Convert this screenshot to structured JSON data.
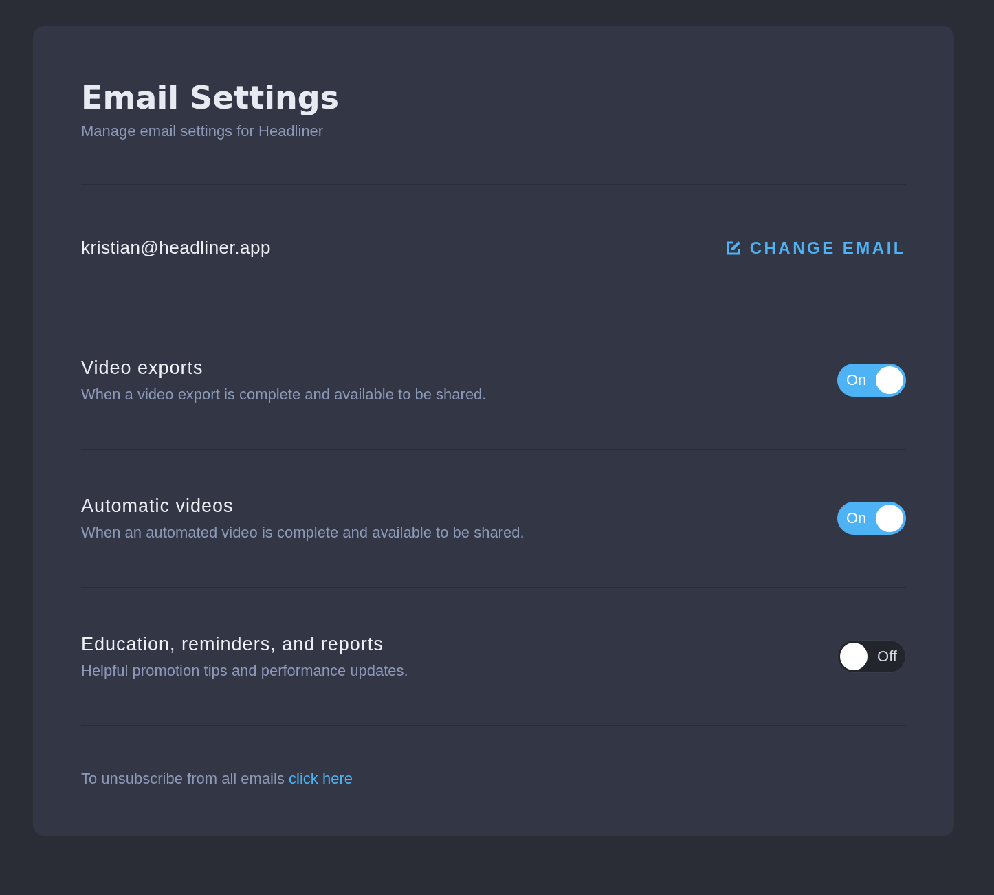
{
  "header": {
    "title": "Email Settings",
    "subtitle": "Manage email settings for Headliner"
  },
  "account": {
    "email": "kristian@headliner.app",
    "change_label": "CHANGE EMAIL"
  },
  "settings": [
    {
      "title": "Video exports",
      "description": "When a video export is complete and available to be shared.",
      "on": true,
      "state_label": "On"
    },
    {
      "title": "Automatic videos",
      "description": "When an automated video is complete and available to be shared.",
      "on": true,
      "state_label": "On"
    },
    {
      "title": "Education, reminders, and reports",
      "description": "Helpful promotion tips and performance updates.",
      "on": false,
      "state_label": "Off"
    }
  ],
  "footer": {
    "text": "To unsubscribe from all emails",
    "link": "click here"
  }
}
